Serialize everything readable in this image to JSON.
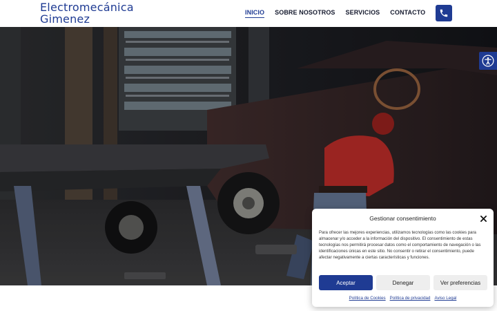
{
  "header": {
    "logo_line1": "Electromecánica",
    "logo_line2": "Gimenez",
    "nav": [
      {
        "label": "INICIO",
        "active": true
      },
      {
        "label": "SOBRE NOSOTROS",
        "active": false
      },
      {
        "label": "SERVICIOS",
        "active": false
      },
      {
        "label": "CONTACTO",
        "active": false
      }
    ],
    "phone_icon": "phone-icon"
  },
  "accessibility": {
    "icon": "accessibility-icon"
  },
  "consent": {
    "title": "Gestionar consentimiento",
    "body": "Para ofrecer las mejores experiencias, utilizamos tecnologías como las cookies para almacenar y/o acceder a la información del dispositivo. El consentimiento de estas tecnologías nos permitirá procesar datos como el comportamiento de navegación o las identificaciones únicas en este sitio. No consentir o retirar el consentimiento, puede afectar negativamente a ciertas características y funciones.",
    "accept_label": "Aceptar",
    "deny_label": "Denegar",
    "prefs_label": "Ver preferencias",
    "links": [
      "Política de Cookies",
      "Política de privacidad",
      "Aviso Legal"
    ]
  },
  "colors": {
    "brand": "#1f3b93",
    "nav_text": "#151a2e"
  }
}
